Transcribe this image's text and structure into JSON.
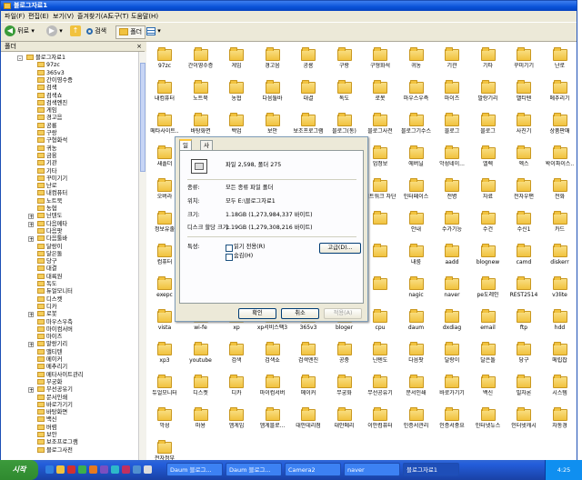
{
  "window": {
    "title": "블로그자료1"
  },
  "menu": [
    "파일(F)",
    "편집(E)",
    "보기(V)",
    "즐겨찾기(A)",
    "도구(T)",
    "도움말(H)"
  ],
  "toolbar": {
    "back": "뒤로",
    "search": "검색",
    "folders": "폴더"
  },
  "pane": {
    "title": "폴더",
    "close": "×"
  },
  "tree": [
    {
      "label": "블로그자료1",
      "level": 0,
      "expand": "-"
    },
    {
      "label": "97zc",
      "level": 1
    },
    {
      "label": "365v3",
      "level": 1
    },
    {
      "label": "간이영수증",
      "level": 1
    },
    {
      "label": "검색",
      "level": 1
    },
    {
      "label": "검색쇼",
      "level": 1
    },
    {
      "label": "검색엔진",
      "level": 1
    },
    {
      "label": "게임",
      "level": 1
    },
    {
      "label": "경고음",
      "level": 1
    },
    {
      "label": "공룡",
      "level": 1
    },
    {
      "label": "구랑",
      "level": 1
    },
    {
      "label": "구형화석",
      "level": 1
    },
    {
      "label": "귀농",
      "level": 1
    },
    {
      "label": "금융",
      "level": 1
    },
    {
      "label": "기관",
      "level": 1
    },
    {
      "label": "기타",
      "level": 1
    },
    {
      "label": "꾸미기기",
      "level": 1
    },
    {
      "label": "난로",
      "level": 1
    },
    {
      "label": "내컴퓨터",
      "level": 1
    },
    {
      "label": "노트북",
      "level": 1
    },
    {
      "label": "농협",
      "level": 1
    },
    {
      "label": "닌텐도",
      "level": 1,
      "expand": "+"
    },
    {
      "label": "다음메타",
      "level": 1,
      "expand": "+"
    },
    {
      "label": "다음팟",
      "level": 1
    },
    {
      "label": "다음툴바",
      "level": 1,
      "expand": "+"
    },
    {
      "label": "달랑이",
      "level": 1
    },
    {
      "label": "달은돌",
      "level": 1
    },
    {
      "label": "당구",
      "level": 1
    },
    {
      "label": "대결",
      "level": 1
    },
    {
      "label": "대륙원",
      "level": 1
    },
    {
      "label": "독도",
      "level": 1
    },
    {
      "label": "듀얼모니터",
      "level": 1
    },
    {
      "label": "디스켓",
      "level": 1
    },
    {
      "label": "디카",
      "level": 1
    },
    {
      "label": "로봇",
      "level": 1,
      "expand": "+"
    },
    {
      "label": "마우스우측",
      "level": 1
    },
    {
      "label": "마이컴서버",
      "level": 1
    },
    {
      "label": "마이즈",
      "level": 1
    },
    {
      "label": "말랑기리",
      "level": 1,
      "expand": "+"
    },
    {
      "label": "맬티텐",
      "level": 1
    },
    {
      "label": "메이커",
      "level": 1
    },
    {
      "label": "메추리기",
      "level": 1
    },
    {
      "label": "메타사이트관리",
      "level": 1
    },
    {
      "label": "무궁화",
      "level": 1
    },
    {
      "label": "무선공유기",
      "level": 1,
      "expand": "+"
    },
    {
      "label": "문서인쇄",
      "level": 1
    },
    {
      "label": "바로가기기",
      "level": 1
    },
    {
      "label": "바탕화면",
      "level": 1
    },
    {
      "label": "백신",
      "level": 1
    },
    {
      "label": "버렴",
      "level": 1
    },
    {
      "label": "보안",
      "level": 1
    },
    {
      "label": "보조프로그램",
      "level": 1
    },
    {
      "label": "블로그사전",
      "level": 1
    }
  ],
  "files": [
    "97zc",
    "간이영수증",
    "게임",
    "경고음",
    "공룡",
    "구랑",
    "구형화석",
    "귀농",
    "기관",
    "기타",
    "꾸미기기",
    "난로",
    "내컴퓨터",
    "노트북",
    "농협",
    "다음툴바",
    "대결",
    "독도",
    "로봇",
    "마우스우측",
    "마이즈",
    "말랑기리",
    "맬티텐",
    "메추리기",
    "메타사이트..",
    "바탕화면",
    "백업",
    "보안",
    "보조프로그램",
    "블로그(동)",
    "블로그사전",
    "블로그기수스",
    "블로그",
    "블로그",
    "사진기",
    "상품판매",
    "새폴더",
    "",
    "",
    "",
    "",
    "",
    "업정보",
    "에버닐",
    "악성네이...",
    "엘렉",
    "엑스",
    "왁이파이스..",
    "오버라",
    "",
    "",
    "",
    "",
    "",
    "네트워크 차단",
    "인터페이스",
    "전병",
    "자료",
    "전자우편",
    "전화",
    "정보유출",
    "",
    "",
    "",
    "",
    "",
    "",
    "안내",
    "수가기능",
    "수건",
    "수신1",
    "카드",
    "컴퓨터",
    "툴바",
    "",
    "",
    "",
    "",
    "",
    "내룸",
    "aadd",
    "blognew",
    "camd",
    "diskerr",
    "exepc",
    "firefox",
    "",
    "",
    "",
    "",
    "",
    "nagic",
    "naver",
    "pe도레인",
    "REST2514",
    "v3lite",
    "vista",
    "wi-fe",
    "xp",
    "xp서비스팩3",
    "365v3",
    "bloger",
    "cpu",
    "daum",
    "dxdiag",
    "email",
    "ftp",
    "hdd",
    "xp3",
    "youtube",
    "검색",
    "검색쇼",
    "검색엔진",
    "공중",
    "닌텐도",
    "다음팟",
    "달랑이",
    "달은돌",
    "당구",
    "메립잡",
    "듀얼모니터",
    "디스켓",
    "디카",
    "마이컴서버",
    "메이커",
    "무궁화",
    "무선공유기",
    "문서인쇄",
    "바로가기기",
    "백신",
    "빌자론",
    "시스템",
    "악성",
    "마용",
    "엠게임",
    "엠게블로...",
    "대안데리점",
    "대안메리",
    "이안컴퓨터",
    "인증서관리",
    "인증서중요",
    "인터넷뉴스",
    "인터넷캐시",
    "자동경",
    "전자정부"
  ],
  "dialog": {
    "tabs": [
      "일반",
      "사용자 지정"
    ],
    "summary": "파일 2,598, 폴더 275",
    "rows": [
      {
        "label": "종류:",
        "value": "모든 종류 파일 폴더"
      },
      {
        "label": "위치:",
        "value": "모두 E:\\블로그자료1"
      },
      {
        "label": "크기:",
        "value": "1.18GB (1,273,984,337 바이트)"
      },
      {
        "label": "디스크 할당 크기:",
        "value": "1.19GB (1,279,308,216 바이트)"
      }
    ],
    "attributes_label": "특성:",
    "readonly": "읽기 전용(R)",
    "hidden": "숨김(H)",
    "advanced": "고급(D)...",
    "ok": "확인",
    "cancel": "취소",
    "apply": "적용(A)"
  },
  "taskbar": {
    "start": "시작",
    "tasks": [
      "Daum 블로그...",
      "Daum 블로그...",
      "Camera2",
      "naver",
      "블로그자료1"
    ],
    "tray": "4:25"
  },
  "colors": {
    "titlebar": "#0a52d8",
    "taskbar": "#245edb",
    "start": "#3c9a3c",
    "folder": "#f1c23e"
  }
}
